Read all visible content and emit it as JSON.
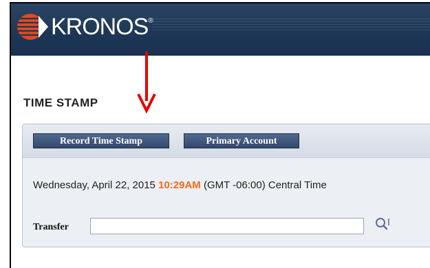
{
  "app": {
    "logo_text": "KRONOS",
    "logo_reg": "®"
  },
  "page": {
    "title": "TIME STAMP"
  },
  "toolbar": {
    "record_label": "Record Time Stamp",
    "primary_label": "Primary Account"
  },
  "datetime": {
    "date": "Wednesday, April 22, 2015",
    "time": "10:29AM",
    "timezone": "(GMT -06:00) Central Time"
  },
  "transfer": {
    "label": "Transfer",
    "value": ""
  },
  "colors": {
    "header_bg": "#1e3756",
    "button_bg": "#3d5478",
    "time_accent": "#f26b1d",
    "arrow": "#e60000"
  },
  "icons": {
    "logo": "kronos-globe-icon",
    "search": "search-icon",
    "annotation": "red-arrow-icon"
  }
}
